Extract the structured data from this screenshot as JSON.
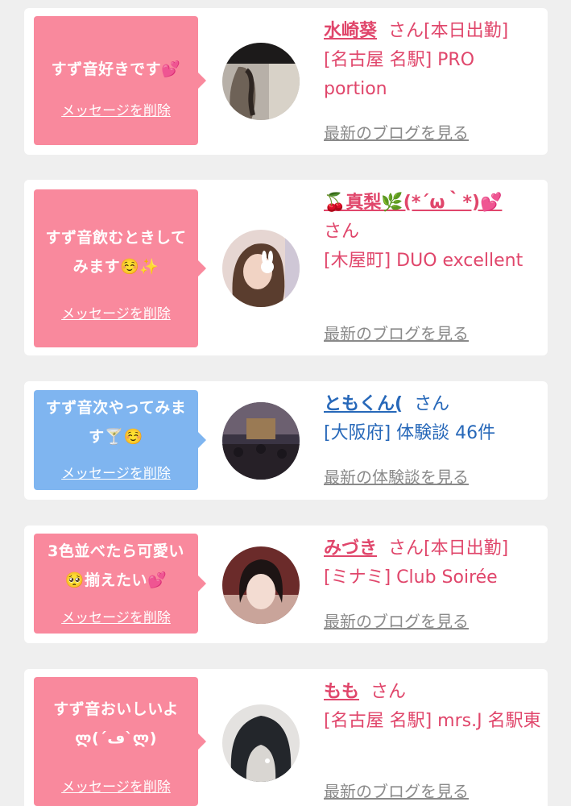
{
  "cards": [
    {
      "message": "すず音好きです💕",
      "delete_label": "メッセージを削除",
      "name": "水崎葵",
      "honorific": "さん",
      "status": "[本日出勤]",
      "shop": "[名古屋 名駅] PRO portion",
      "blog_link": "最新のブログを見る"
    },
    {
      "message": "すず音飲むときしてみます☺️✨",
      "delete_label": "メッセージを削除",
      "name": "🍒真梨🌿(*´ω｀*)💕",
      "honorific": "さん",
      "status": "",
      "shop": "[木屋町] DUO excellent",
      "blog_link": "最新のブログを見る"
    },
    {
      "message": "すず音次やってみます🍸☺️",
      "delete_label": "メッセージを削除",
      "name": "ともくん(",
      "honorific": "さん",
      "status": "",
      "shop": "[大阪府] 体験談 46件",
      "blog_link": "最新の体験談を見る"
    },
    {
      "message": "3色並べたら可愛い🥺揃えたい💕",
      "delete_label": "メッセージを削除",
      "name": "みづき",
      "honorific": "さん",
      "status": "[本日出勤]",
      "shop": "[ミナミ] Club Soirée",
      "blog_link": "最新のブログを見る"
    },
    {
      "message": "すず音おいしいよლ(´ڡ`ლ)",
      "delete_label": "メッセージを削除",
      "name": "もも",
      "honorific": "さん",
      "status": "",
      "shop": "[名古屋 名駅] mrs.J 名駅東",
      "blog_link": "最新のブログを見る"
    }
  ],
  "colors": {
    "page_bg": "#efefef",
    "bubble_pink": "#f9899d",
    "bubble_blue": "#7fb5f0",
    "text_pink": "#e0466b",
    "text_blue": "#2768b9",
    "link_gray": "#8a8a8a"
  }
}
